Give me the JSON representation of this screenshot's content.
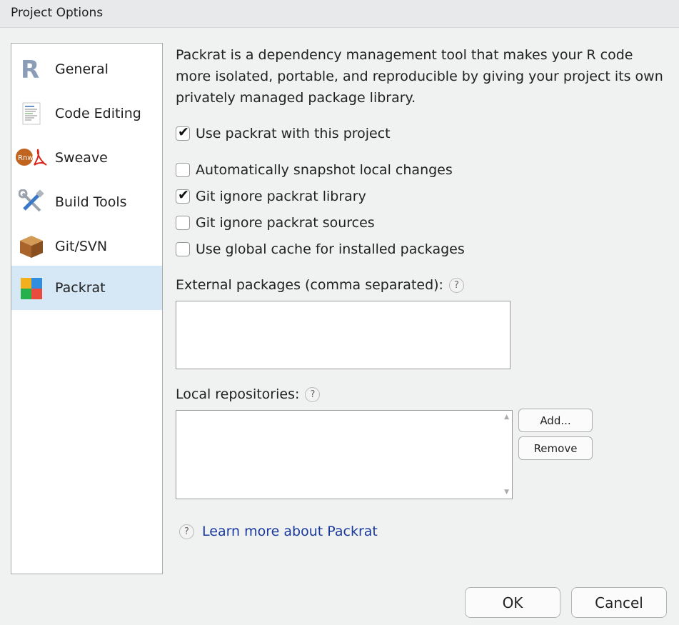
{
  "window": {
    "title": "Project Options"
  },
  "sidebar": {
    "items": [
      {
        "label": "General",
        "icon": "r-logo-icon"
      },
      {
        "label": "Code Editing",
        "icon": "code-document-icon"
      },
      {
        "label": "Sweave",
        "icon": "sweave-icon"
      },
      {
        "label": "Build Tools",
        "icon": "build-tools-icon"
      },
      {
        "label": "Git/SVN",
        "icon": "git-box-icon"
      },
      {
        "label": "Packrat",
        "icon": "packrat-icon",
        "selected": true
      }
    ]
  },
  "main": {
    "description": "Packrat is a dependency management tool that makes your R code more isolated, portable, and reproducible by giving your project its own privately managed package library.",
    "use_packrat": {
      "label": "Use packrat with this project",
      "checked": true
    },
    "options": [
      {
        "label": "Automatically snapshot local changes",
        "checked": false
      },
      {
        "label": "Git ignore packrat library",
        "checked": true
      },
      {
        "label": "Git ignore packrat sources",
        "checked": false
      },
      {
        "label": "Use global cache for installed packages",
        "checked": false
      }
    ],
    "external_packages": {
      "label": "External packages (comma separated):",
      "value": ""
    },
    "local_repositories": {
      "label": "Local repositories:",
      "items": []
    },
    "add_button": "Add...",
    "remove_button": "Remove",
    "learn_more": "Learn more about Packrat",
    "help_glyph": "?"
  },
  "footer": {
    "ok": "OK",
    "cancel": "Cancel"
  },
  "colors": {
    "selection": "#d6e8f6",
    "link": "#1a3a9c",
    "background": "#f0f1f1"
  }
}
